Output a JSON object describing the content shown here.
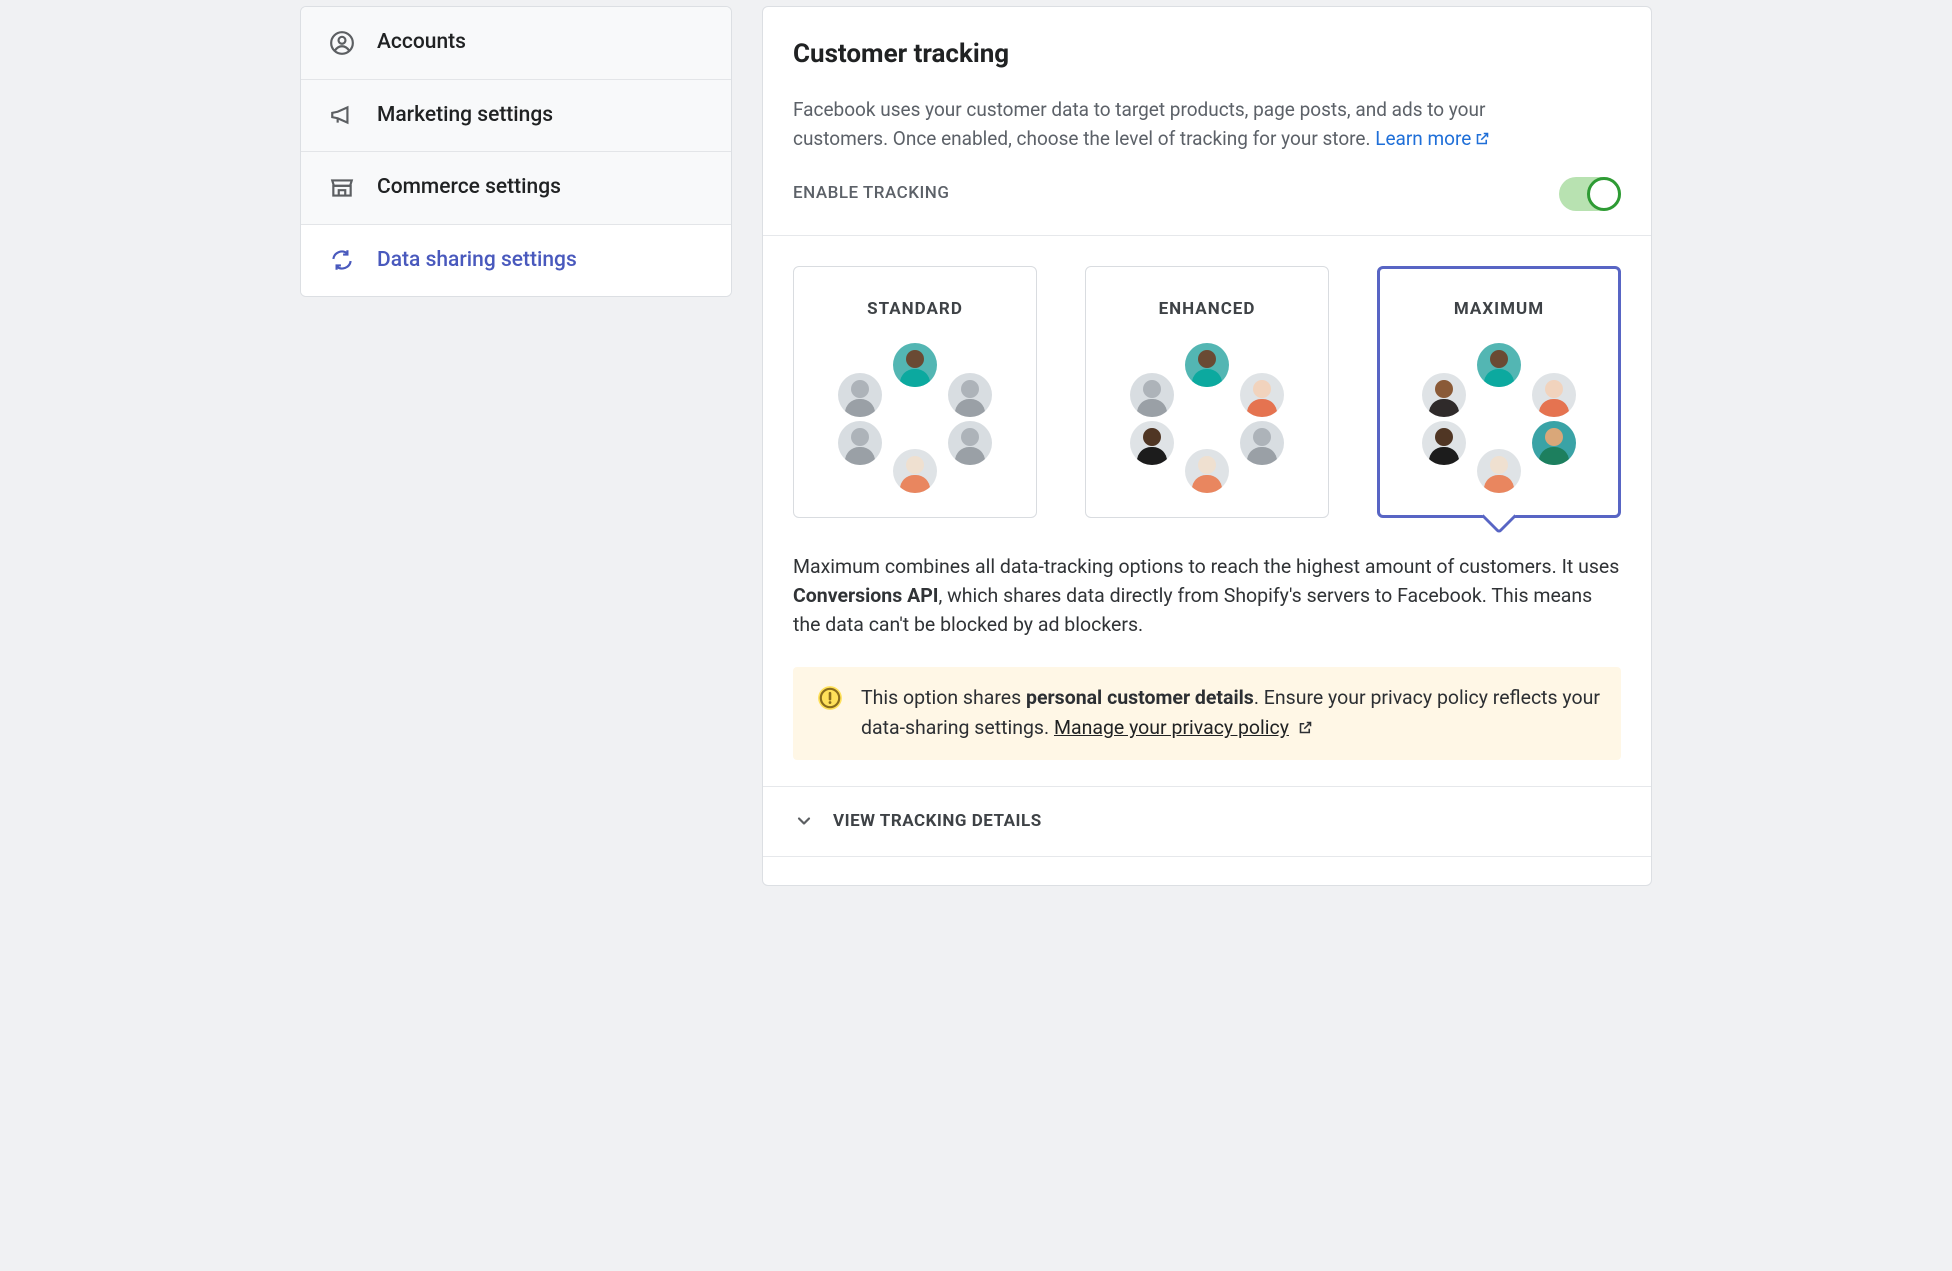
{
  "sidebar": {
    "items": [
      {
        "id": "accounts",
        "label": "Accounts",
        "icon": "user-circle-icon",
        "active": false
      },
      {
        "id": "marketing",
        "label": "Marketing settings",
        "icon": "megaphone-icon",
        "active": false
      },
      {
        "id": "commerce",
        "label": "Commerce settings",
        "icon": "storefront-icon",
        "active": false
      },
      {
        "id": "datasharing",
        "label": "Data sharing settings",
        "icon": "sync-icon",
        "active": true
      }
    ]
  },
  "header": {
    "title": "Customer tracking",
    "description_pre": "Facebook uses your customer data to target products, page posts, and ads to your customers. Once enabled, choose the level of tracking for your store. ",
    "learn_more_label": "Learn more"
  },
  "enable": {
    "label": "ENABLE TRACKING",
    "value": true
  },
  "options": [
    {
      "id": "standard",
      "title": "STANDARD",
      "colored_count": 2,
      "selected": false
    },
    {
      "id": "enhanced",
      "title": "ENHANCED",
      "colored_count": 4,
      "selected": false
    },
    {
      "id": "maximum",
      "title": "MAXIMUM",
      "colored_count": 6,
      "selected": true
    }
  ],
  "selected_description": {
    "pre": "Maximum combines all data-tracking options to reach the highest amount of customers. It uses ",
    "bold": "Conversions API",
    "post": ", which shares data directly from Shopify's servers to Facebook. This means the data can't be blocked by ad blockers."
  },
  "warning": {
    "pre": "This option shares ",
    "bold": "personal customer details",
    "post": ". Ensure your privacy policy reflects your data-sharing settings. ",
    "link_label": "Manage your privacy policy"
  },
  "details": {
    "label": "VIEW TRACKING DETAILS",
    "expanded": false
  }
}
